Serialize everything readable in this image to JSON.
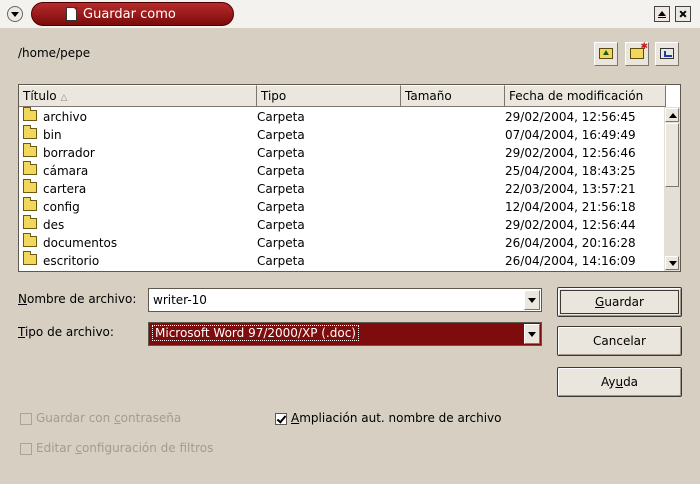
{
  "window": {
    "title": "Guardar como"
  },
  "location": {
    "path": "/home/pepe"
  },
  "toolbar": {
    "icons": [
      "folder-up-icon",
      "new-folder-icon",
      "default-directory-icon"
    ]
  },
  "file_list": {
    "columns": [
      "Título",
      "Tipo",
      "Tamaño",
      "Fecha de modificación"
    ],
    "sort_indicator": "△",
    "rows": [
      {
        "name": "archivo",
        "type": "Carpeta",
        "size": "",
        "modified": "29/02/2004, 12:56:45"
      },
      {
        "name": "bin",
        "type": "Carpeta",
        "size": "",
        "modified": "07/04/2004, 16:49:49"
      },
      {
        "name": "borrador",
        "type": "Carpeta",
        "size": "",
        "modified": "29/02/2004, 12:56:46"
      },
      {
        "name": "cámara",
        "type": "Carpeta",
        "size": "",
        "modified": "25/04/2004, 18:43:25"
      },
      {
        "name": "cartera",
        "type": "Carpeta",
        "size": "",
        "modified": "22/03/2004, 13:57:21"
      },
      {
        "name": "config",
        "type": "Carpeta",
        "size": "",
        "modified": "12/04/2004, 21:56:18"
      },
      {
        "name": "des",
        "type": "Carpeta",
        "size": "",
        "modified": "29/02/2004, 12:56:44"
      },
      {
        "name": "documentos",
        "type": "Carpeta",
        "size": "",
        "modified": "26/04/2004, 20:16:28"
      },
      {
        "name": "escritorio",
        "type": "Carpeta",
        "size": "",
        "modified": "26/04/2004, 14:16:09"
      }
    ]
  },
  "form": {
    "filename_label_mnemonic": "N",
    "filename_label_rest": "ombre de archivo:",
    "filename_value": "writer-10",
    "filetype_label_mnemonic": "T",
    "filetype_label_rest": "ipo de archivo:",
    "filetype_value": "Microsoft Word 97/2000/XP (.doc)"
  },
  "buttons": {
    "save_mnemonic": "G",
    "save_rest": "uardar",
    "cancel": "Cancelar",
    "help_pre": "Ay",
    "help_mnemonic": "u",
    "help_post": "da"
  },
  "options": {
    "password": {
      "pre": "Guardar con ",
      "mnemonic": "c",
      "post": "ontraseña",
      "checked": false,
      "enabled": false
    },
    "auto_ext": {
      "pre": "",
      "mnemonic": "A",
      "post": "mpliación aut. nombre de archivo",
      "checked": true,
      "enabled": true
    },
    "filter": {
      "pre": "Editar ",
      "mnemonic": "c",
      "post": "onfiguración de filtros",
      "checked": false,
      "enabled": false
    }
  },
  "colors": {
    "title_active": "#8a1414",
    "selection": "#7e0c0c",
    "dialog_background": "#d6cfc2"
  }
}
